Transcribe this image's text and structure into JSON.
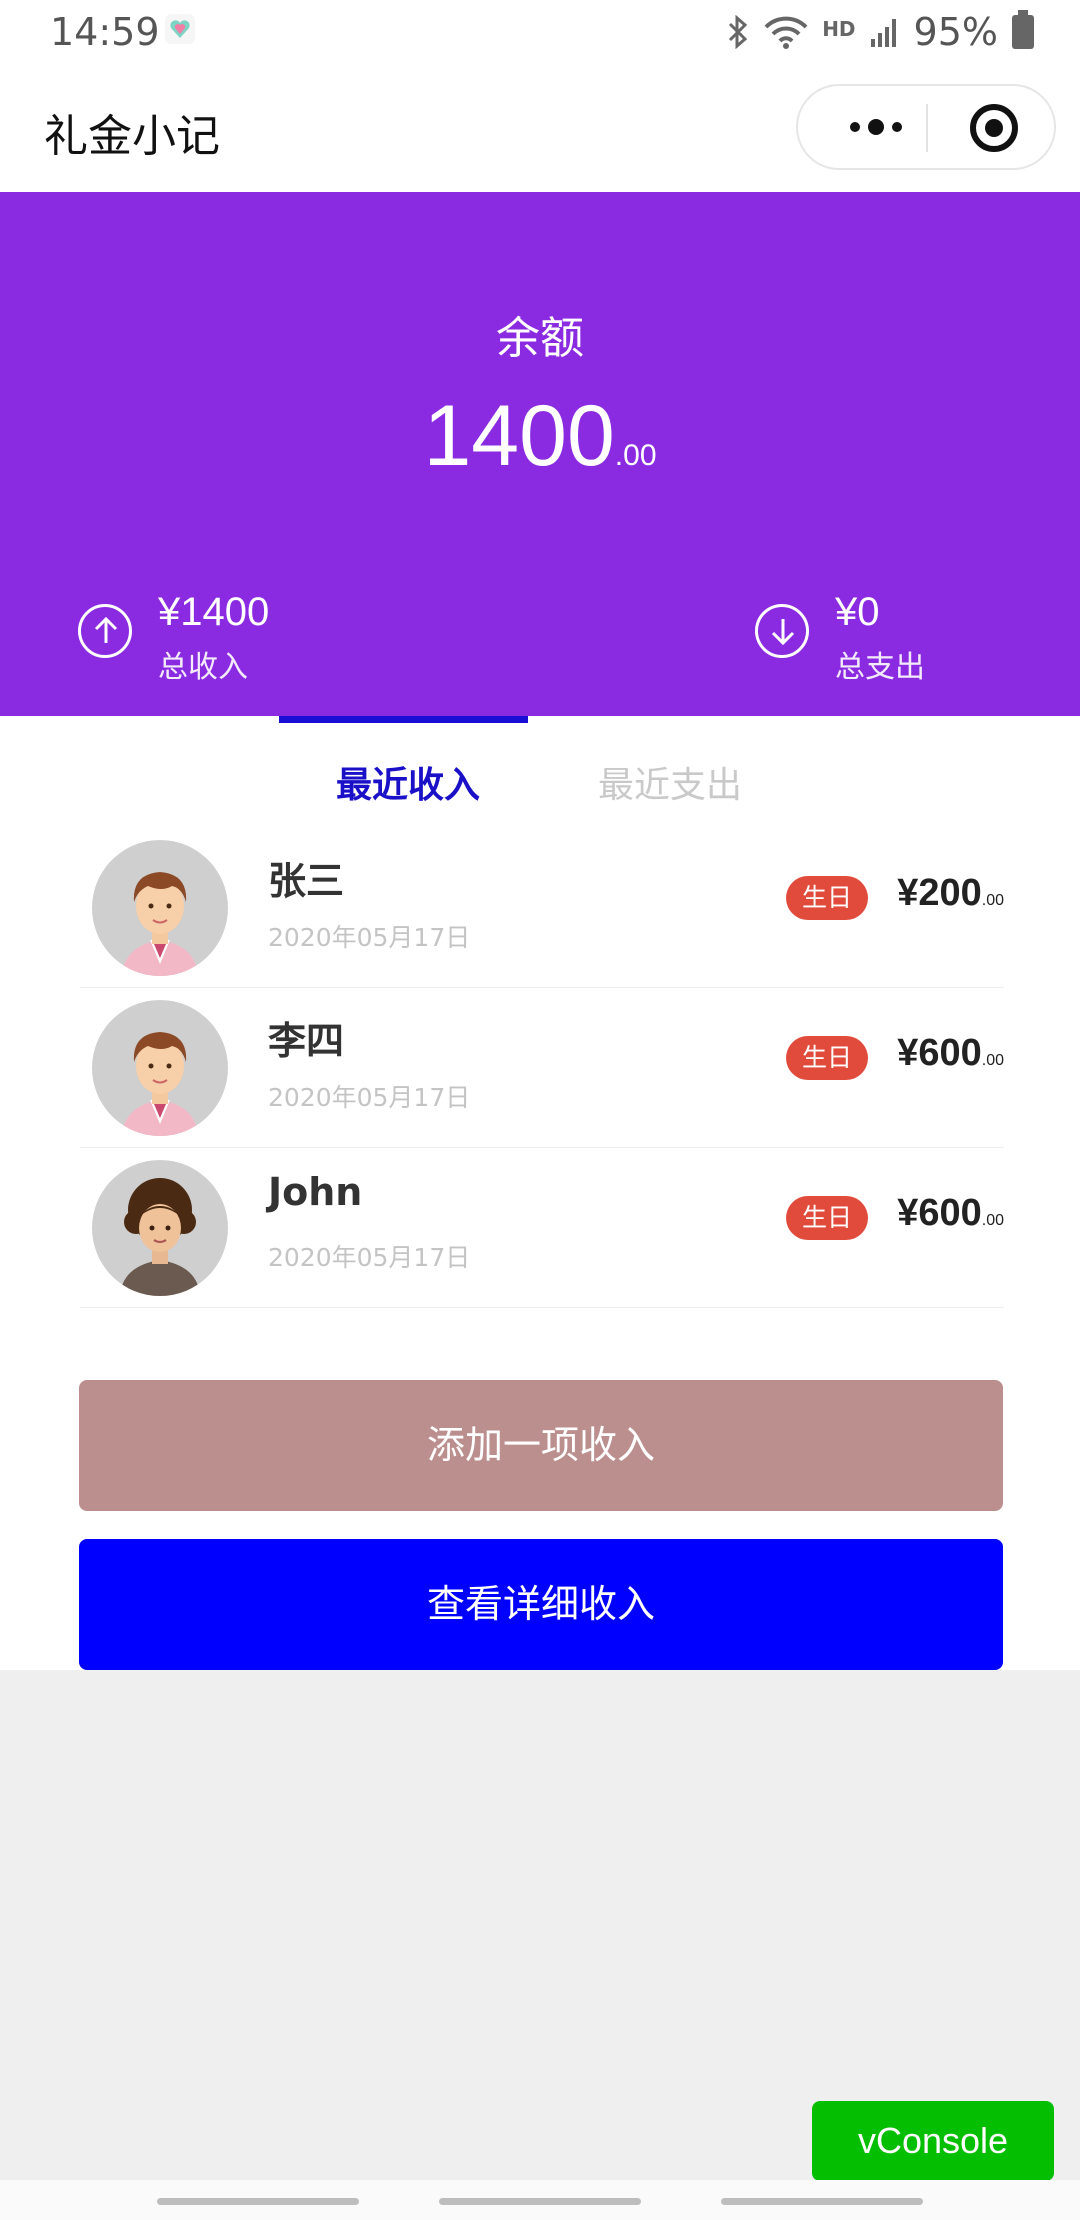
{
  "status_bar": {
    "time": "14:59",
    "network": "HD",
    "battery": "95%",
    "icons": [
      "heart-icon",
      "bluetooth-icon",
      "wifi-icon",
      "signal-icon",
      "battery-icon"
    ]
  },
  "nav": {
    "title": "礼金小记",
    "icons": [
      "more-icon",
      "close-mini-program-icon"
    ]
  },
  "summary": {
    "balance_label": "余额",
    "balance_int": "1400",
    "balance_dec": ".00",
    "income_value": "¥1400",
    "income_label": "总收入",
    "expense_value": "¥0",
    "expense_label": "总支出",
    "color": "#8a2be2"
  },
  "tabs": [
    {
      "label": "最近收入",
      "active": true
    },
    {
      "label": "最近支出",
      "active": false
    }
  ],
  "records": [
    {
      "name": "张三",
      "date": "2020年05月17日",
      "tag": "生日",
      "amount_int": "¥200",
      "amount_dec": ".00",
      "avatar": "man-avatar"
    },
    {
      "name": "李四",
      "date": "2020年05月17日",
      "tag": "生日",
      "amount_int": "¥600",
      "amount_dec": ".00",
      "avatar": "man-avatar"
    },
    {
      "name": "John",
      "date": "2020年05月17日",
      "tag": "生日",
      "amount_int": "¥600",
      "amount_dec": ".00",
      "avatar": "curly-hair-avatar"
    }
  ],
  "buttons": {
    "add_income": "添加一项收入",
    "view_details": "查看详细收入"
  },
  "vconsole": "vConsole",
  "colors": {
    "accent_purple": "#8a2be2",
    "tab_active": "#1a10c8",
    "tag_red": "#e14b3c",
    "add_button": "#bc8f8f",
    "detail_button": "#0000ff",
    "vconsole_green": "#04be02"
  }
}
